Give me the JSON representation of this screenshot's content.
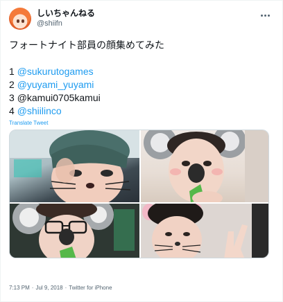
{
  "user": {
    "display_name": "しいちゃんねる",
    "handle": "@shiifn"
  },
  "tweet": {
    "text_intro": "フォートナイト部員の顔集めてみた",
    "list": [
      {
        "num": "1",
        "name": "@sukurutogames",
        "is_link": true
      },
      {
        "num": "2",
        "name": "@yuyami_yuyami",
        "is_link": true
      },
      {
        "num": "3",
        "name": "@kamui0705kamui",
        "is_link": false
      },
      {
        "num": "4",
        "name": "@shiilinco",
        "is_link": true
      }
    ],
    "translate_label": "Translate Tweet"
  },
  "meta": {
    "time": "7:13 PM",
    "separator": "·",
    "date": "Jul 9, 2018",
    "source": "Twitter for iPhone"
  },
  "icons": {
    "more": "more-horizontal-icon"
  },
  "colors": {
    "link": "#1d9bf0",
    "text": "#0f1419",
    "secondary": "#536471",
    "border": "#cfd9de"
  }
}
